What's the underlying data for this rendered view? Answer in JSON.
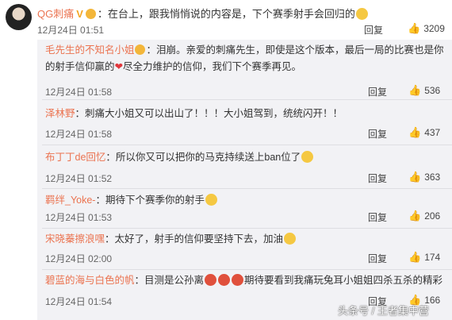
{
  "post": {
    "author": "QG刺痛",
    "verified_mark": "V",
    "text": "：在台上，跟我悄悄说的内容是，下个赛季射手会回归的",
    "time": "12月24日 01:51",
    "reply_label": "回复",
    "like_count": "3209"
  },
  "comments": [
    {
      "name": "毛先生的不知名小姐",
      "text": "：泪崩。亲爱的刺痛先生，即使是这个版本，最后一局的比赛也是你",
      "text2": "的射手信仰赢的",
      "text3": "尽全力维护的信仰，我们下个赛季再见。",
      "time": "12月24日 01:58",
      "reply": "回复",
      "likes": "536"
    },
    {
      "name": "泽林野",
      "text": "：刺痛大小姐又可以出山了！！！大小姐驾到，统统闪开！！",
      "time": "12月24日 01:58",
      "reply": "回复",
      "likes": "437"
    },
    {
      "name": "布丁丁de回忆",
      "text": "：所以你又可以把你的马克持续送上ban位了",
      "time": "12月24日 01:52",
      "reply": "回复",
      "likes": "363"
    },
    {
      "name": "羁绊_Yoke-",
      "text": "：期待下个赛季你的射手",
      "time": "12月24日 01:53",
      "reply": "回复",
      "likes": "206"
    },
    {
      "name": "宋晓蓁擦浪嘿",
      "text": "：太好了，射手的信仰要坚持下去，加油",
      "time": "12月24日 02:00",
      "reply": "回复",
      "likes": "174"
    },
    {
      "name": "碧蓝的海与白色的帆",
      "text": "：目测是公孙离",
      "text2": "期待要看到我痛玩兔耳小姐姐四杀五杀的精彩",
      "time": "12月24日 01:54",
      "reply": "回复",
      "likes": "166"
    }
  ],
  "watermark": "头条号 / 王者集中营",
  "icons": {
    "like": "thumbs-up-icon",
    "emoji": "emoji-icon",
    "heart": "heart-icon"
  },
  "colors": {
    "username": "#eb7350",
    "reply_bg": "#f2f2f5"
  }
}
